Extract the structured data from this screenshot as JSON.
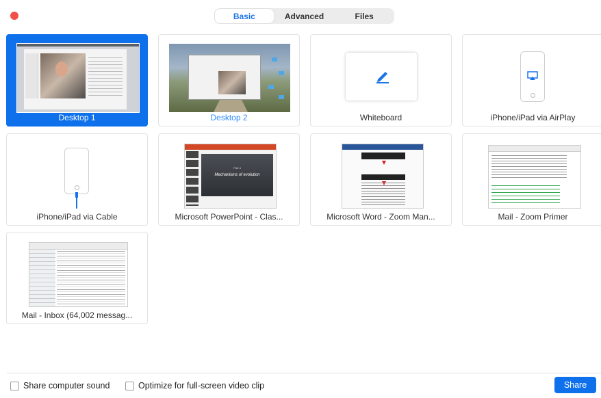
{
  "tabs": [
    {
      "label": "Basic",
      "active": true
    },
    {
      "label": "Advanced",
      "active": false
    },
    {
      "label": "Files",
      "active": false
    }
  ],
  "tiles": [
    {
      "label": "Desktop 1",
      "selected": true
    },
    {
      "label": "Desktop 2",
      "selected": false
    },
    {
      "label": "Whiteboard",
      "selected": false
    },
    {
      "label": "iPhone/iPad via AirPlay",
      "selected": false
    },
    {
      "label": "iPhone/iPad via Cable",
      "selected": false
    },
    {
      "label": "Microsoft PowerPoint - Clas...",
      "selected": false
    },
    {
      "label": "Microsoft Word - Zoom Man...",
      "selected": false
    },
    {
      "label": "Mail - Zoom Primer",
      "selected": false
    },
    {
      "label": "Mail - Inbox (64,002 messag...",
      "selected": false
    }
  ],
  "ppt_slide": {
    "small": "Part 4",
    "title": "Mechanisms of evolution"
  },
  "footer": {
    "share_sound_label": "Share computer sound",
    "optimize_label": "Optimize for full-screen video clip",
    "share_button": "Share"
  },
  "colors": {
    "accent": "#0e71eb",
    "close": "#f0504b"
  }
}
